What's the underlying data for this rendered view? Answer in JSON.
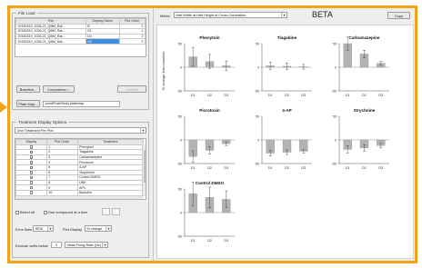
{
  "file_load": {
    "title": "File Load",
    "headers": [
      "File",
      "Display Name",
      "Plot Order"
    ],
    "rows": [
      {
        "file": "20150319_1026-21_QBM_Rat...",
        "display": "B",
        "order": "0",
        "selected": false
      },
      {
        "file": "20150319_1026-21_QBM_Rat...",
        "display": "D1",
        "order": "1",
        "selected": false
      },
      {
        "file": "20150319_1026-21_QBM_Rat...",
        "display": "D2",
        "order": "2",
        "selected": false
      },
      {
        "file": "20150319_1026-21_QBM_Rat...",
        "display": "D3",
        "order": "3",
        "selected": true
      }
    ],
    "baseline_label": "Baseline...",
    "comparison_label": "Comparison...",
    "confirm_label": "Confirm",
    "plate_map_label": "Plate Map...",
    "plate_map_value": "proofFinalStudy.platemap"
  },
  "treatment": {
    "title": "Treatment Display Options",
    "mode_value": "One Treatment Per Plot",
    "headers": [
      "Display",
      "Plot Order",
      "Treatment"
    ],
    "rows": [
      {
        "checked": true,
        "order": "1",
        "name": "Phenytoin"
      },
      {
        "checked": true,
        "order": "2",
        "name": "Tiagabine"
      },
      {
        "checked": true,
        "order": "3",
        "name": "Carbamazepine"
      },
      {
        "checked": true,
        "order": "4",
        "name": "Picrotoxin"
      },
      {
        "checked": true,
        "order": "5",
        "name": "4-AP"
      },
      {
        "checked": true,
        "order": "6",
        "name": "Strychnine"
      },
      {
        "checked": true,
        "order": "7",
        "name": "Control DMSO"
      },
      {
        "checked": false,
        "order": "8",
        "name": "UNK"
      },
      {
        "checked": false,
        "order": "9",
        "name": "APV"
      },
      {
        "checked": false,
        "order": "10",
        "name": "Baclofen"
      }
    ],
    "select_all_label": "Select all",
    "one_compound_label": "One compound at a time",
    "error_bars_label": "Error Bars",
    "error_bars_value": "SEM",
    "plot_display_label": "Plot Display",
    "plot_display_value": "% change",
    "exclude_label": "Exclude wells below",
    "exclude_value": "0",
    "metric_value": "Mean Firing Rate (Hz)"
  },
  "right": {
    "metric_label": "Metric",
    "metric_value": "Half Width at Half Height of Cross-Correlation",
    "title": "BETA",
    "copy_label": "Copy"
  },
  "chart_data": {
    "type": "bar",
    "ylabel": "% change from baseline",
    "yticks": [
      "50",
      "0",
      "-50"
    ],
    "ylim": [
      -50,
      50
    ],
    "categories": [
      "D1",
      "D2",
      "D3"
    ],
    "bar_color": "#b3b3b3",
    "panels": [
      {
        "title": "Phenytoin",
        "values": [
          22,
          12,
          3
        ],
        "errors": [
          20,
          15,
          10
        ]
      },
      {
        "title": "Tiagabine",
        "values": [
          3,
          2,
          1
        ],
        "errors": [
          8,
          7,
          5
        ]
      },
      {
        "title": "Carbamazepine",
        "values": [
          50,
          28,
          8
        ],
        "errors": [
          14,
          8,
          4
        ]
      },
      {
        "title": "Picrotoxin",
        "values": [
          -35,
          -22,
          -8
        ],
        "errors": [
          12,
          8,
          4
        ]
      },
      {
        "title": "4-AP",
        "values": [
          -28,
          -26,
          -24
        ],
        "errors": [
          6,
          5,
          4
        ]
      },
      {
        "title": "Strychnine",
        "values": [
          -20,
          -17,
          -12
        ],
        "errors": [
          8,
          7,
          5
        ]
      },
      {
        "title": "Control DMSO",
        "values": [
          40,
          32,
          28
        ],
        "errors": [
          25,
          22,
          18
        ]
      }
    ]
  }
}
